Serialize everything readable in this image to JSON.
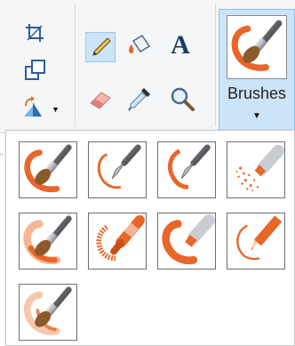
{
  "brushes_button": {
    "label": "Brushes",
    "caret": "▼"
  },
  "toolbar": {
    "image_group": {
      "tools": [
        {
          "name": "crop-icon"
        },
        {
          "name": "resize-icon"
        },
        {
          "name": "rotate-icon",
          "caret": "▼"
        }
      ]
    },
    "tools_group": {
      "tools": [
        {
          "name": "pencil-icon",
          "selected": true
        },
        {
          "name": "fill-bucket-icon"
        },
        {
          "name": "text-icon",
          "glyph": "A"
        },
        {
          "name": "eraser-icon"
        },
        {
          "name": "color-picker-icon"
        },
        {
          "name": "magnifier-icon"
        }
      ]
    }
  },
  "brush_styles": [
    {
      "name": "brush",
      "icon": "paintbrush-icon"
    },
    {
      "name": "calligraphy-brush-1",
      "icon": "calligraphy-pen-icon"
    },
    {
      "name": "calligraphy-brush-2",
      "icon": "calligraphy-pen-icon"
    },
    {
      "name": "airbrush",
      "icon": "airbrush-icon"
    },
    {
      "name": "oil-brush",
      "icon": "oil-brush-icon"
    },
    {
      "name": "crayon",
      "icon": "crayon-icon"
    },
    {
      "name": "marker",
      "icon": "marker-icon"
    },
    {
      "name": "natural-pencil",
      "icon": "natural-pencil-icon"
    },
    {
      "name": "watercolor-brush",
      "icon": "watercolor-brush-icon"
    }
  ],
  "colors": {
    "stroke_orange": "#e8662a",
    "selection_blue": "#cce4f7",
    "selection_border": "#8ec1ea"
  }
}
